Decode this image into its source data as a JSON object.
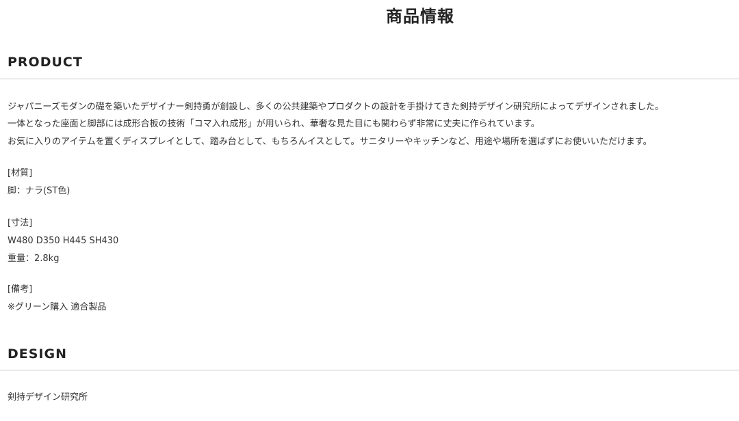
{
  "page_title": "商品情報",
  "product_section": {
    "heading": "PRODUCT",
    "description_lines": [
      "ジャパニーズモダンの礎を築いたデザイナー剣持勇が創設し、多くの公共建築やプロダクトの設計を手掛けてきた剣持デザイン研究所によってデザインされました。",
      "一体となった座面と脚部には成形合板の技術「コマ入れ成形」が用いられ、華奢な見た目にも関わらず非常に丈夫に作られています。",
      "お気に入りのアイテムを置くディスプレイとして、踏み台として、もちろんイスとして。サニタリーやキッチンなど、用途や場所を選ばずにお使いいただけます。"
    ],
    "material_label": "[材質]",
    "material_value": "脚：ナラ(ST色)",
    "dimensions_label": "[寸法]",
    "dimensions_value": "W480 D350 H445 SH430",
    "weight_value": "重量：2.8kg",
    "notes_label": "[備考]",
    "notes_value": "※グリーン購入 適合製品"
  },
  "design_section": {
    "heading": "DESIGN",
    "designer": "剣持デザイン研究所"
  }
}
